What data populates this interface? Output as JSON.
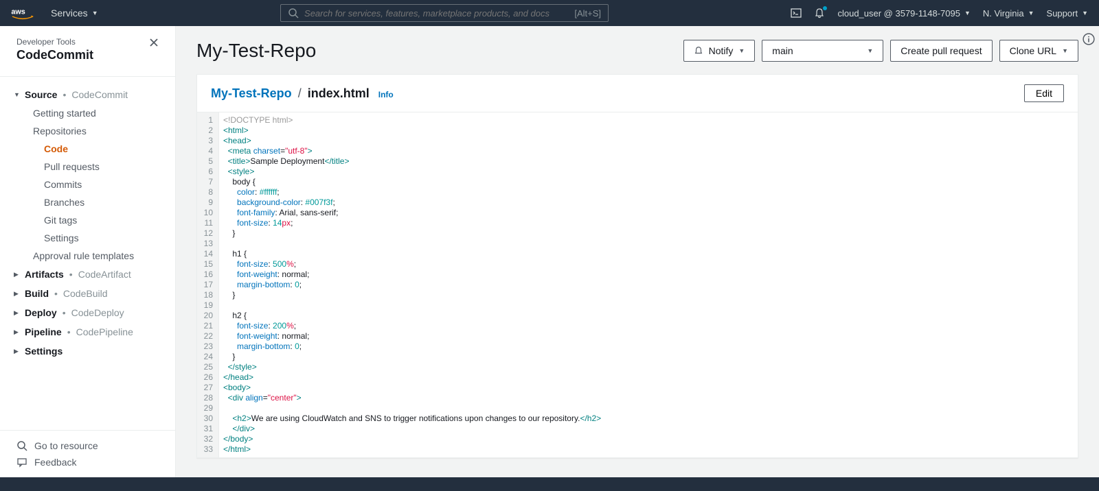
{
  "topnav": {
    "services": "Services",
    "search_placeholder": "Search for services, features, marketplace products, and docs",
    "search_shortcut": "[Alt+S]",
    "user": "cloud_user @ 3579-1148-7095",
    "region": "N. Virginia",
    "support": "Support"
  },
  "sidebar": {
    "subtitle": "Developer Tools",
    "title": "CodeCommit",
    "groups": [
      {
        "name": "Source",
        "service": "CodeCommit",
        "expanded": true,
        "children": [
          {
            "label": "Getting started"
          },
          {
            "label": "Repositories",
            "children": [
              {
                "label": "Code",
                "active": true
              },
              {
                "label": "Pull requests"
              },
              {
                "label": "Commits"
              },
              {
                "label": "Branches"
              },
              {
                "label": "Git tags"
              },
              {
                "label": "Settings"
              }
            ]
          },
          {
            "label": "Approval rule templates"
          }
        ]
      },
      {
        "name": "Artifacts",
        "service": "CodeArtifact",
        "expanded": false
      },
      {
        "name": "Build",
        "service": "CodeBuild",
        "expanded": false
      },
      {
        "name": "Deploy",
        "service": "CodeDeploy",
        "expanded": false
      },
      {
        "name": "Pipeline",
        "service": "CodePipeline",
        "expanded": false
      },
      {
        "name": "Settings",
        "service": "",
        "expanded": false
      }
    ],
    "footer": {
      "resource": "Go to resource",
      "feedback": "Feedback"
    }
  },
  "header": {
    "repo_name": "My-Test-Repo",
    "notify": "Notify",
    "branch": "main",
    "create_pr": "Create pull request",
    "clone": "Clone URL"
  },
  "file_panel": {
    "bc_repo": "My-Test-Repo",
    "bc_file": "index.html",
    "info": "Info",
    "edit": "Edit"
  },
  "code": {
    "line_count": 33,
    "file": {
      "doctype": "<!DOCTYPE html>",
      "title_text": "Sample Deployment",
      "meta_charset": "utf-8",
      "body_css": {
        "color": "#ffffff",
        "background-color": "#007f3f",
        "font-family": "Arial, sans-serif",
        "font-size": "14px"
      },
      "h1_css": {
        "font-size": "500%",
        "font-weight": "normal",
        "margin-bottom": "0"
      },
      "h2_css": {
        "font-size": "200%",
        "font-weight": "normal",
        "margin-bottom": "0"
      },
      "div_align": "center",
      "h2_text": "We are using CloudWatch and SNS to trigger notifications upon changes to our repository."
    }
  }
}
